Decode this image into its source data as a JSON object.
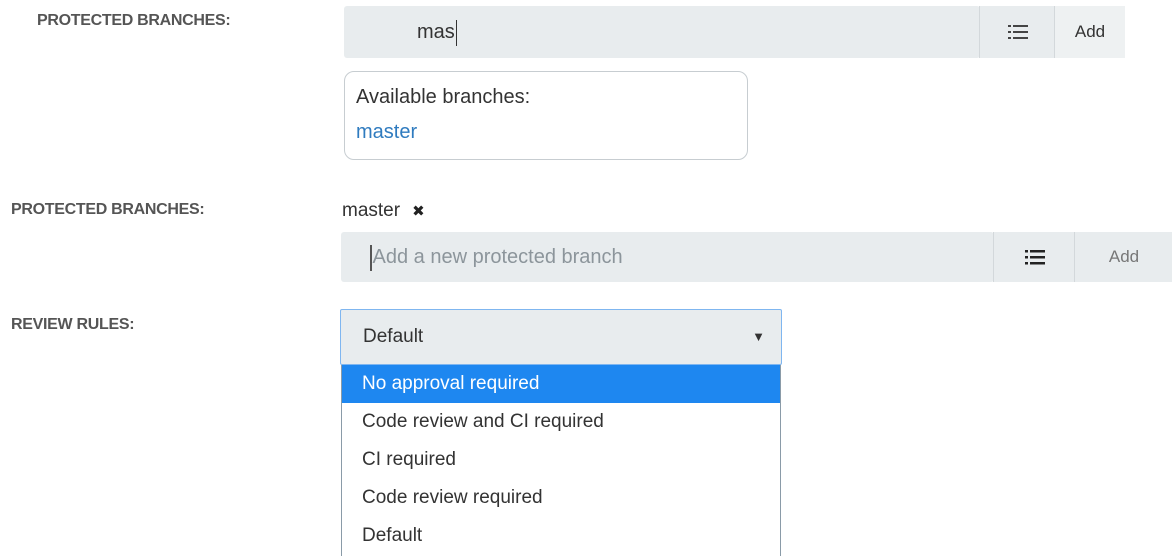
{
  "section1": {
    "label": "PROTECTED BRANCHES:",
    "input_value": "mas",
    "list_icon": "list-icon",
    "add_label": "Add",
    "suggest": {
      "heading": "Available branches:",
      "items": [
        "master"
      ]
    }
  },
  "section2": {
    "label": "PROTECTED BRANCHES:",
    "tags": [
      {
        "name": "master",
        "remove_icon": "close-icon",
        "remove_glyph": "✖"
      }
    ],
    "input_placeholder": "Add a new protected branch",
    "list_icon": "list-icon",
    "add_label": "Add"
  },
  "review": {
    "label": "REVIEW RULES:",
    "selected": "Default",
    "arrow_glyph": "▼",
    "options": [
      "No approval required",
      "Code review and CI required",
      "CI required",
      "Code review required",
      "Default"
    ],
    "highlighted_index": 0
  },
  "colors": {
    "input_bg": "#e8ecee",
    "highlight": "#1e87f0",
    "link": "#2f7bbf"
  }
}
